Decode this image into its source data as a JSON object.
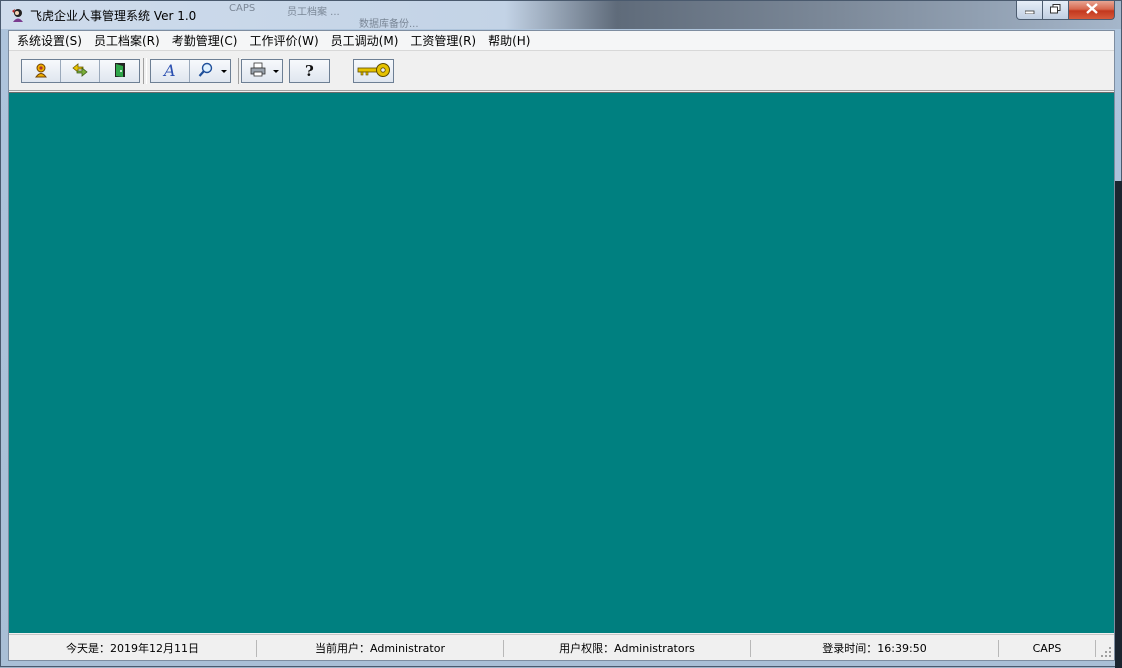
{
  "window": {
    "title": "飞虎企业人事管理系统 Ver 1.0",
    "background_ghost": [
      "CAPS",
      "员工档案 ...",
      "数据库备份..."
    ],
    "controls": {
      "minimize": "minimize-icon",
      "maximize": "maximize-icon",
      "close": "close-icon"
    }
  },
  "menu": [
    "系统设置(S)",
    "员工档案(R)",
    "考勤管理(C)",
    "工作评价(W)",
    "员工调动(M)",
    "工资管理(R)",
    "帮助(H)"
  ],
  "toolbar": {
    "groups": [
      [
        "user-icon",
        "exchange-icon",
        "door-exit-icon"
      ],
      [
        "font-icon",
        "search-icon"
      ],
      [
        "printer-icon"
      ],
      [
        "help-icon"
      ],
      [
        "key-icon"
      ]
    ]
  },
  "workspace": {
    "background_color": "#008080"
  },
  "status": {
    "date": "今天是：2019年12月11日",
    "user": "当前用户：Administrator",
    "rights": "用户权限：Administrators",
    "login_time": "登录时间：16:39:50",
    "caps": "CAPS"
  },
  "colors": {
    "mdi": "#008080",
    "frame": "#aec4dc",
    "close": "#c3381e"
  }
}
